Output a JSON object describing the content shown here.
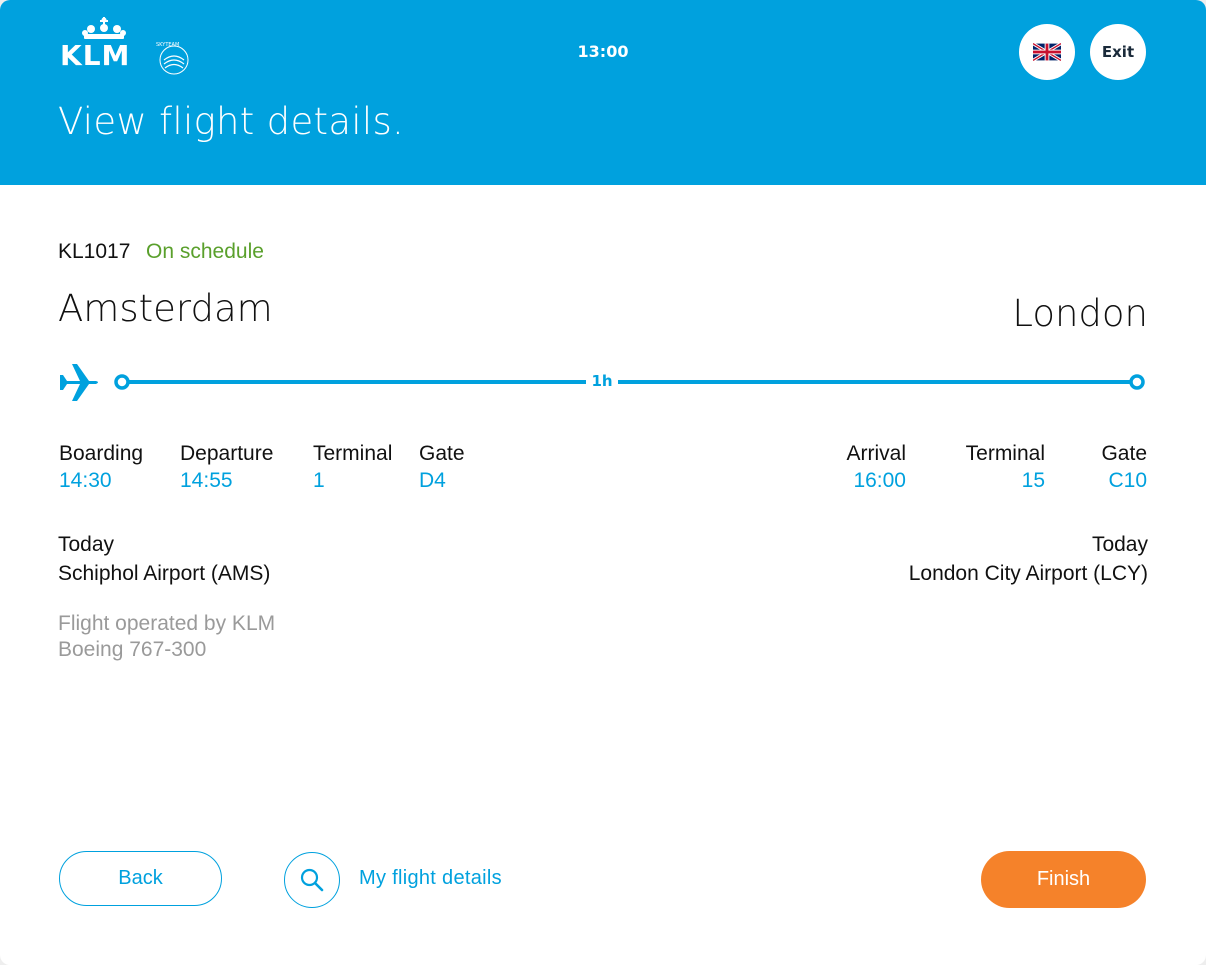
{
  "header": {
    "brand": "KLM",
    "brand_tag": "SKYTEAM",
    "clock": "13:00",
    "title": "View flight details.",
    "exit_label": "Exit",
    "language_icon": "uk-flag-icon"
  },
  "flight": {
    "number": "KL1017",
    "status": "On schedule",
    "from_city": "Amsterdam",
    "to_city": "London",
    "duration": "1h",
    "departure": {
      "boarding_label": "Boarding",
      "boarding": "14:30",
      "departure_label": "Departure",
      "departure": "14:55",
      "terminal_label": "Terminal",
      "terminal": "1",
      "gate_label": "Gate",
      "gate": "D4",
      "day": "Today",
      "airport": "Schiphol Airport (AMS)"
    },
    "arrival": {
      "arrival_label": "Arrival",
      "arrival": "16:00",
      "terminal_label": "Terminal",
      "terminal": "15",
      "gate_label": "Gate",
      "gate": "C10",
      "day": "Today",
      "airport": "London City Airport (LCY)"
    },
    "operator": "Flight operated by KLM",
    "aircraft": "Boeing 767-300"
  },
  "footer": {
    "back_label": "Back",
    "my_flight_label": "My flight details",
    "finish_label": "Finish"
  },
  "colors": {
    "brand_blue": "#00a1de",
    "status_green": "#5aa02c",
    "finish_orange": "#f5822a",
    "muted_grey": "#9a9a9a"
  }
}
